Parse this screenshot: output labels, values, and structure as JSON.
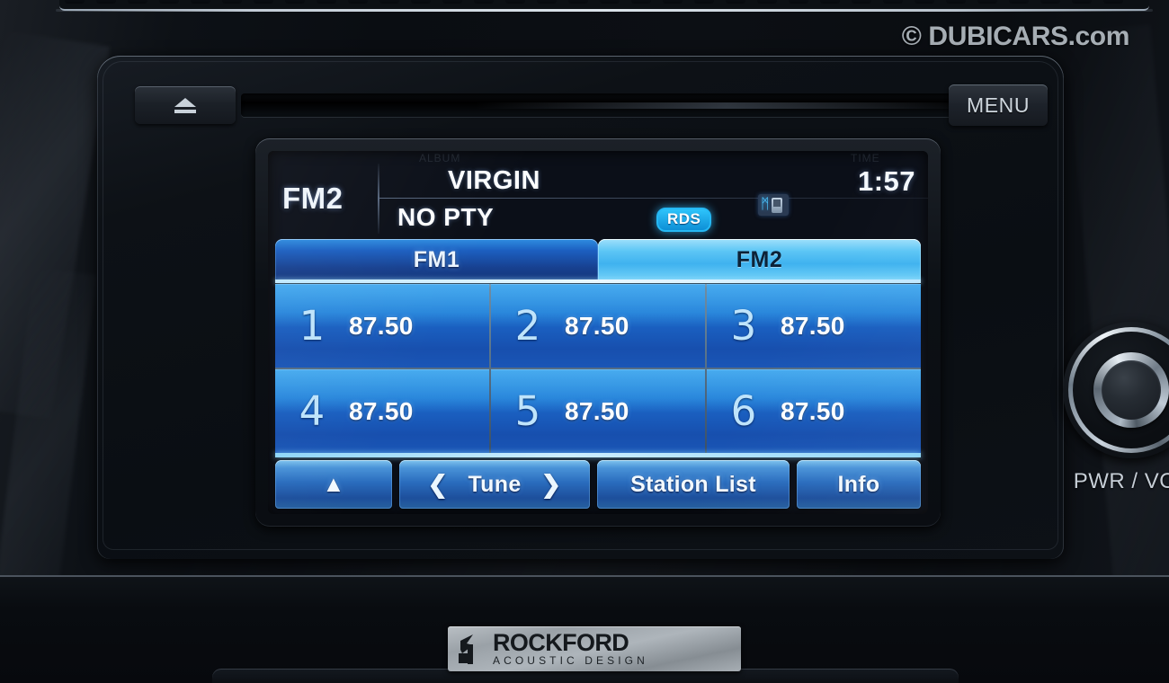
{
  "watermark": {
    "text": "© DUBICARS.com"
  },
  "head_unit": {
    "eject_button": {
      "icon": "eject-icon",
      "label": ""
    },
    "menu_button": {
      "label": "MENU"
    },
    "knob": {
      "label": "PWR / VOL",
      "icon": "rotary-knob"
    },
    "brand_plate": {
      "name": "ROCKFORD",
      "tagline": "ACOUSTIC DESIGN"
    }
  },
  "screen": {
    "ghost_row": {
      "left_text": "ALBUM",
      "right_text": "TIME"
    },
    "status": {
      "band": "FM2",
      "station_name": "VIRGIN",
      "program_type": "NO PTY",
      "rds_badge": "RDS",
      "bluetooth_icon": "bluetooth-phone-icon",
      "clock": "1:57"
    },
    "band_tabs": [
      {
        "label": "FM1",
        "active": false
      },
      {
        "label": "FM2",
        "active": true
      }
    ],
    "presets": [
      {
        "number": "1",
        "frequency": "87.50"
      },
      {
        "number": "2",
        "frequency": "87.50"
      },
      {
        "number": "3",
        "frequency": "87.50"
      },
      {
        "number": "4",
        "frequency": "87.50"
      },
      {
        "number": "5",
        "frequency": "87.50"
      },
      {
        "number": "6",
        "frequency": "87.50"
      }
    ],
    "function_buttons": {
      "scroll_up": {
        "label": "▲",
        "name": "scroll-up-icon"
      },
      "tune": {
        "prev": "❮",
        "label": "Tune",
        "next": "❯"
      },
      "station_list": {
        "label": "Station List"
      },
      "info": {
        "label": "Info"
      }
    }
  },
  "colors": {
    "accent_cyan": "#3fb2ef",
    "tab_inactive_blue": "#1c5fc0",
    "preset_blue": "#1f7fd8",
    "rds_badge": "#2ec4fb",
    "screen_text": "#fbfdff",
    "bezel_black": "#0a0d12",
    "badge_silver": "#a7aeb4"
  }
}
